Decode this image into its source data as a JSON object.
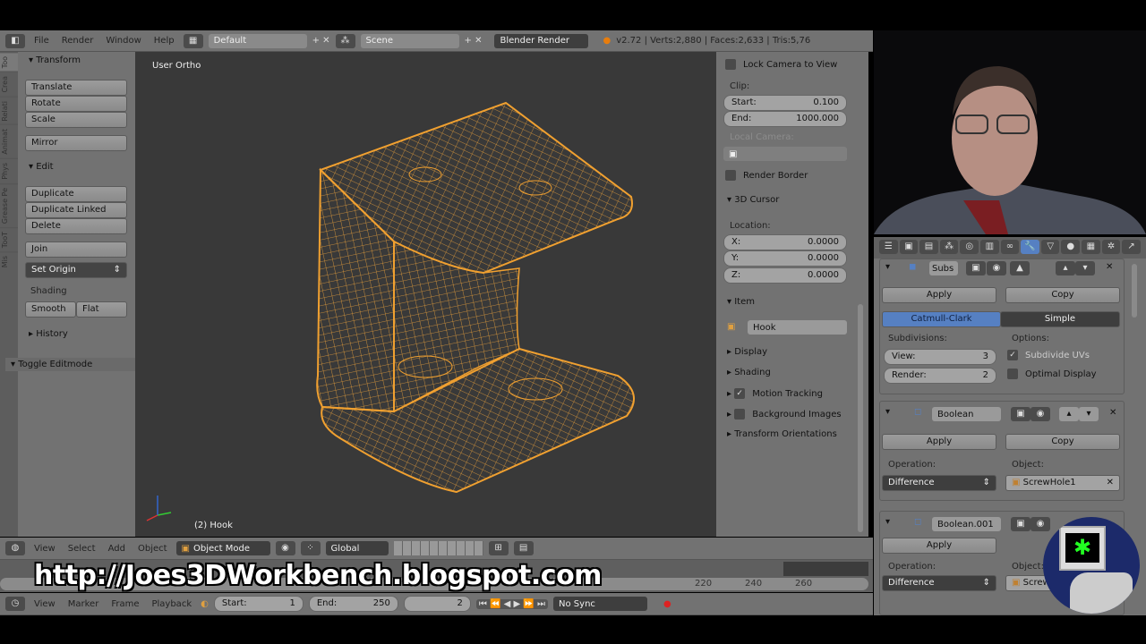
{
  "header": {
    "menus": [
      "File",
      "Render",
      "Window",
      "Help"
    ],
    "layout": "Default",
    "scene": "Scene",
    "engine": "Blender Render",
    "stats": "v2.72 | Verts:2,880 | Faces:2,633 | Tris:5,76"
  },
  "tool_tabs": [
    "Too",
    "Crea",
    "Relati",
    "Animat",
    "Phys",
    "Grease Pe",
    "TooT",
    "Mis"
  ],
  "toolshelf": {
    "transform": "Transform",
    "transform_buttons": [
      "Translate",
      "Rotate",
      "Scale"
    ],
    "mirror": "Mirror",
    "edit": "Edit",
    "edit_buttons": [
      "Duplicate",
      "Duplicate Linked",
      "Delete"
    ],
    "join": "Join",
    "set_origin": "Set Origin",
    "shading": "Shading",
    "smooth": "Smooth",
    "flat": "Flat",
    "history": "History",
    "toggle_editmode": "Toggle Editmode"
  },
  "viewport": {
    "view_name": "User Ortho",
    "object_label": "(2) Hook",
    "wire_color": "#f0a030"
  },
  "npanel": {
    "lock_camera": "Lock Camera to View",
    "clip": "Clip:",
    "clip_start_label": "Start:",
    "clip_start": "0.100",
    "clip_end_label": "End:",
    "clip_end": "1000.000",
    "local_camera": "Local Camera:",
    "render_border": "Render Border",
    "cursor": "3D Cursor",
    "location": "Location:",
    "x_label": "X:",
    "x": "0.0000",
    "y_label": "Y:",
    "y": "0.0000",
    "z_label": "Z:",
    "z": "0.0000",
    "item": "Item",
    "item_name": "Hook",
    "display": "Display",
    "shading": "Shading",
    "motion_tracking": "Motion Tracking",
    "background_images": "Background Images",
    "transform_orientations": "Transform Orientations"
  },
  "view3d_header": {
    "menus": [
      "View",
      "Select",
      "Add",
      "Object"
    ],
    "mode": "Object Mode",
    "orientation": "Global"
  },
  "watermark": "http://Joes3DWorkbench.blogspot.com",
  "timeline": {
    "ticks": [
      "220",
      "240",
      "260"
    ],
    "menus": [
      "View",
      "Marker",
      "Frame",
      "Playback"
    ],
    "start_label": "Start:",
    "start": "1",
    "end_label": "End:",
    "end": "250",
    "current": "2",
    "sync": "No Sync"
  },
  "modifiers": {
    "subsurf": {
      "name": "Subs",
      "apply": "Apply",
      "copy": "Copy",
      "catmull": "Catmull-Clark",
      "simple": "Simple",
      "subdivisions": "Subdivisions:",
      "view_label": "View:",
      "view": "3",
      "render_label": "Render:",
      "render": "2",
      "options": "Options:",
      "subdivide_uvs": "Subdivide UVs",
      "optimal_display": "Optimal Display"
    },
    "boolean": {
      "name": "Boolean",
      "apply": "Apply",
      "copy": "Copy",
      "operation_label": "Operation:",
      "operation": "Difference",
      "object_label": "Object:",
      "object": "ScrewHole1"
    },
    "boolean2": {
      "name": "Boolean.001",
      "apply": "Apply",
      "operation_label": "Operation:",
      "operation": "Difference",
      "object_label": "Object:",
      "object": "Screw"
    }
  },
  "accent": "#5680c2"
}
